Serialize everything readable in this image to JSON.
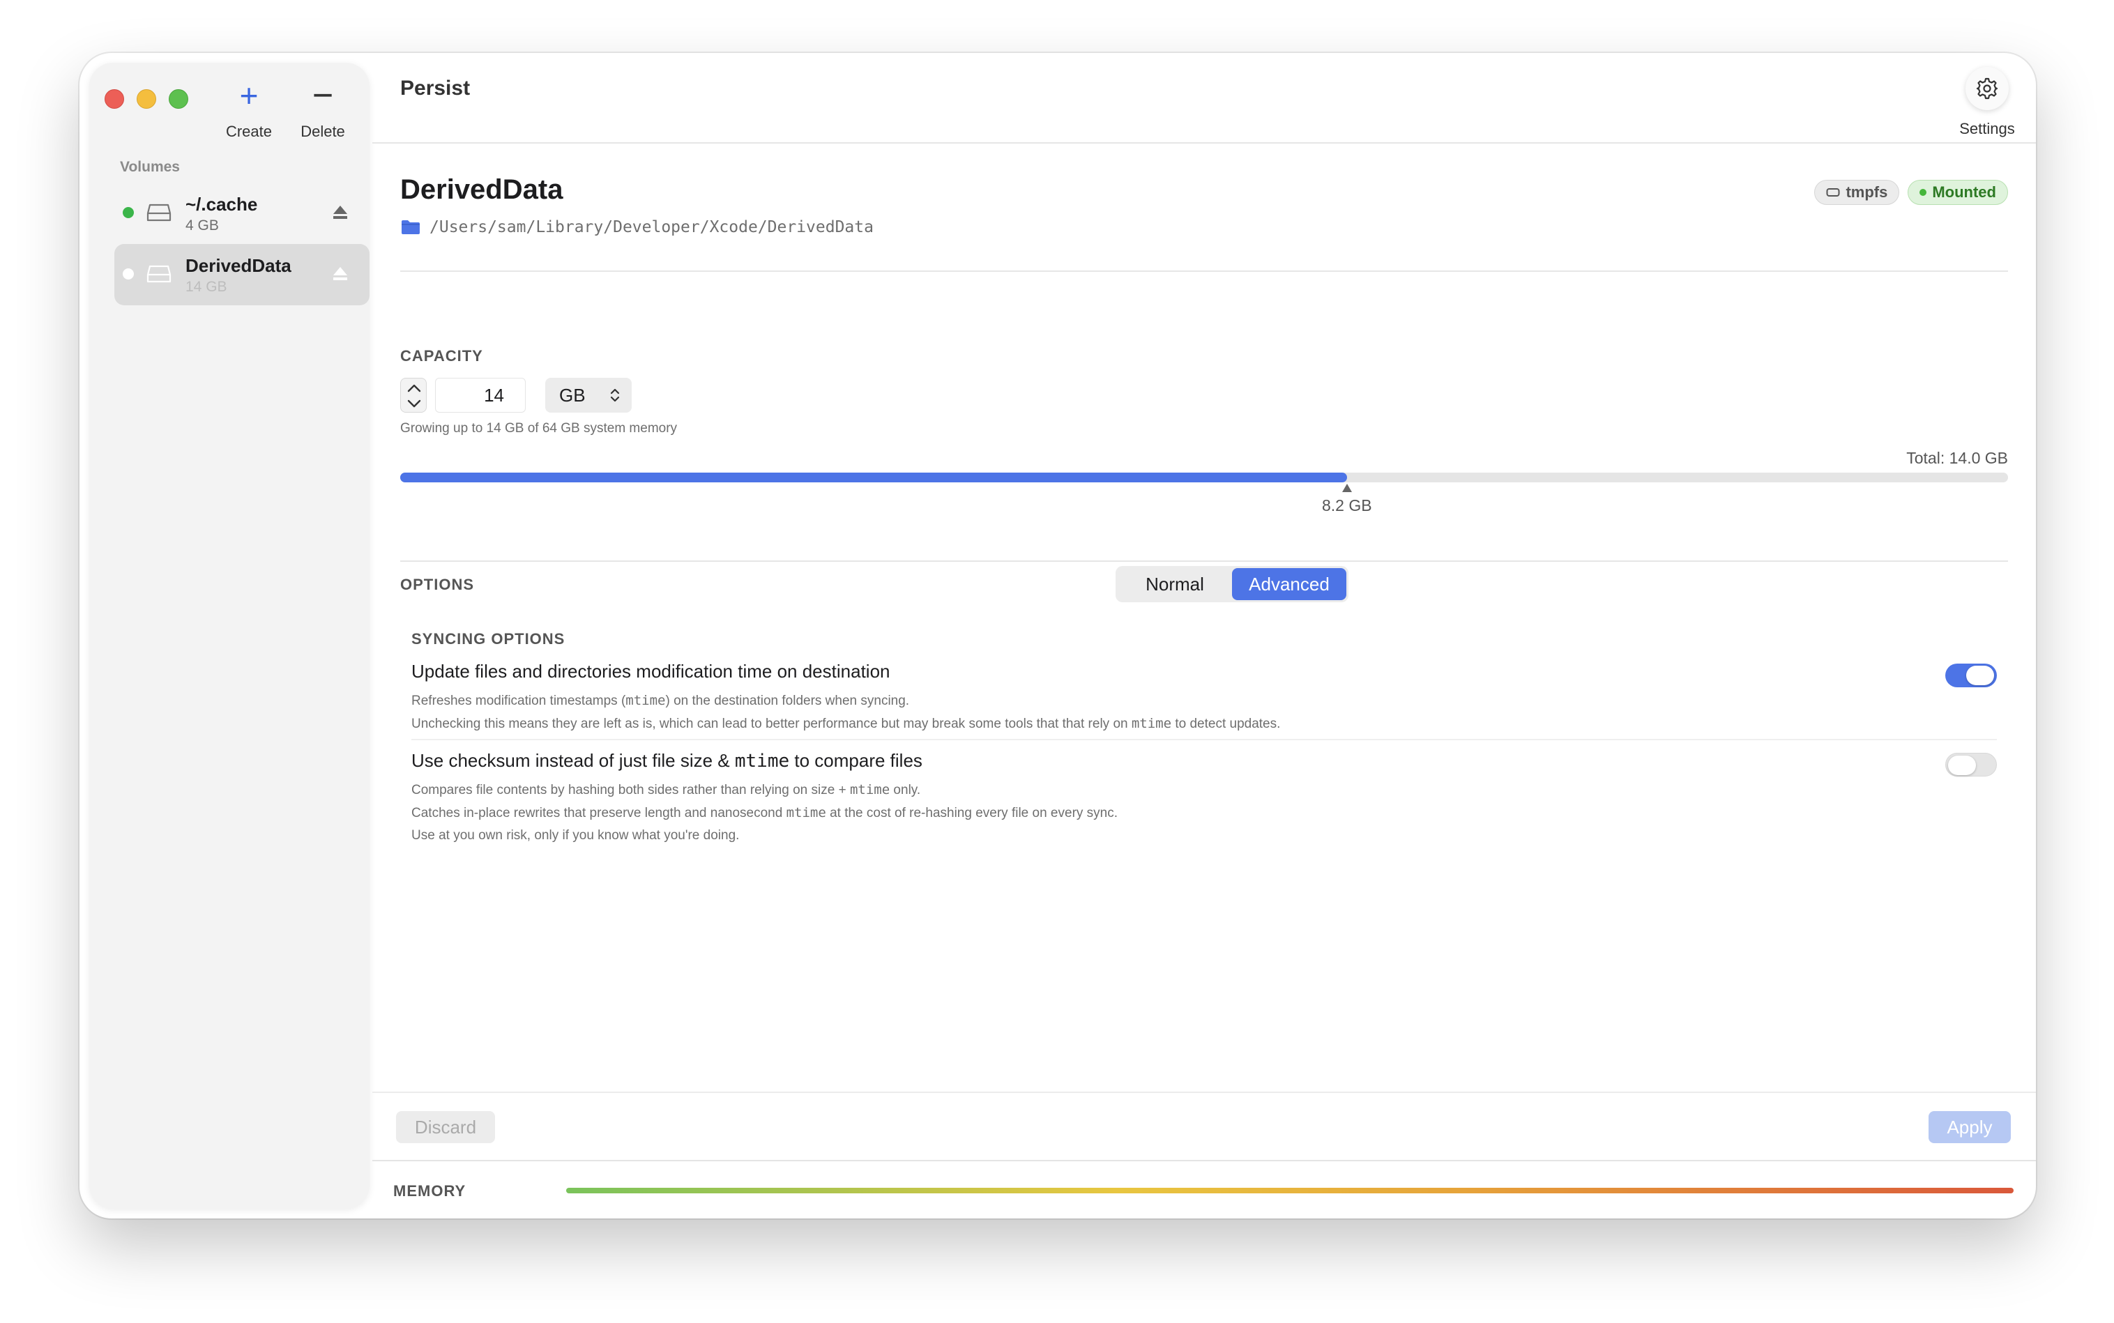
{
  "toolbar": {
    "create_label": "Create",
    "delete_label": "Delete",
    "settings_label": "Settings",
    "app_title": "Persist"
  },
  "sidebar": {
    "section_label": "Volumes",
    "items": [
      {
        "name": "~/.cache",
        "size": "4 GB",
        "status_color": "#3bb54a",
        "selected": false
      },
      {
        "name": "DerivedData",
        "size": "14 GB",
        "status_color": "#ffffff",
        "selected": true
      }
    ]
  },
  "detail": {
    "title": "DerivedData",
    "path": "/Users/sam/Library/Developer/Xcode/DerivedData",
    "badges": {
      "filesystem": "tmpfs",
      "status": "Mounted"
    },
    "capacity": {
      "label": "CAPACITY",
      "value": "14",
      "unit": "GB",
      "hint": "Growing up to 14 GB of 64 GB system memory",
      "total_label": "Total: 14.0 GB",
      "used_label": "8.2 GB",
      "used_fraction": 0.589
    },
    "options": {
      "label": "OPTIONS",
      "modes": [
        "Normal",
        "Advanced"
      ],
      "selected_mode": "Advanced",
      "syncing_label": "SYNCING OPTIONS",
      "items": [
        {
          "title": "Update files and directories modification time on destination",
          "desc_line1_pre": "Refreshes modification timestamps (",
          "desc_line1_code": "mtime",
          "desc_line1_post": ") on the destination folders when syncing.",
          "desc_line2_pre": "Unchecking this means they are left as is, which can lead to better performance but may break some tools that that rely on ",
          "desc_line2_code": "mtime",
          "desc_line2_post": " to detect updates.",
          "enabled": true
        },
        {
          "title_pre": "Use checksum instead of just file size & ",
          "title_code": "mtime",
          "title_post": " to compare files",
          "desc_line1_pre": "Compares file contents by hashing both sides rather than relying on size + ",
          "desc_line1_code": "mtime",
          "desc_line1_post": " only.",
          "desc_line2_pre": "Catches in-place rewrites that preserve length and nanosecond ",
          "desc_line2_code": "mtime",
          "desc_line2_post": " at the cost of re-hashing every file on every sync.",
          "desc_line3": "Use at you own risk, only if you know what you're doing.",
          "enabled": false
        }
      ]
    }
  },
  "footer": {
    "discard_label": "Discard",
    "apply_label": "Apply",
    "memory_label": "MEMORY"
  },
  "colors": {
    "accent": "#4d74e6",
    "mounted_green": "#45b63a",
    "close": "#ec5f57",
    "minimize": "#f4be3e",
    "zoom": "#5dc04f"
  }
}
